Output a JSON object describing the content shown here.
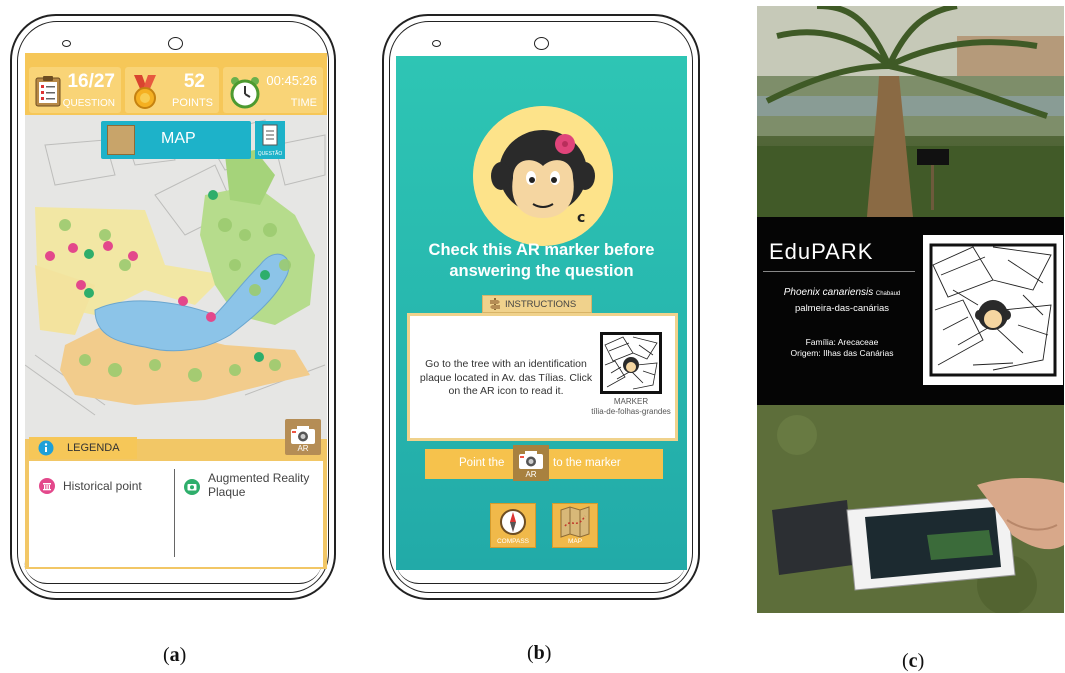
{
  "panel_a": {
    "question_count": "16/27",
    "question_label": "QUESTION",
    "points_value": "52",
    "points_label": "POINTS",
    "time_value": "00:45:26",
    "time_label": "TIME",
    "map_button": "MAP",
    "question_button": "QUESTÃO",
    "ar_button": "AR",
    "legend_title": "LEGENDA",
    "legend_items": [
      "Historical point",
      "Augmented Reality Plaque"
    ],
    "colors": {
      "topbar": "#f6c758",
      "map_button": "#1db2c9",
      "historical": "#e3488b",
      "ar_plaque": "#2eae6b"
    }
  },
  "panel_b": {
    "heading": "Check this AR marker before answering the question",
    "instructions_tab": "INSTRUCTIONS",
    "instruction_text": "Go to the tree with an identification plaque located in Av. das Tílias. Click on the AR icon to read it.",
    "marker_caption_1": "MARKER",
    "marker_caption_2": "tília-de-folhas-grandes",
    "point_left": "Point the",
    "point_ar": "AR",
    "point_right": "to the marker",
    "compass_label": "COMPASS",
    "map_label": "MAP",
    "colors": {
      "background": "#2ec5b4",
      "accent": "#f6c24c"
    }
  },
  "panel_c": {
    "sign_logo": "EduPARK",
    "species_name": "Phoenix canariensis",
    "species_author": "Chabaud",
    "common_name": "palmeira-das-canárias",
    "family": "Família: Arecaceae",
    "origin": "Origem: Ilhas das Canárias"
  },
  "captions": {
    "a": "a",
    "b": "b",
    "c": "c"
  }
}
